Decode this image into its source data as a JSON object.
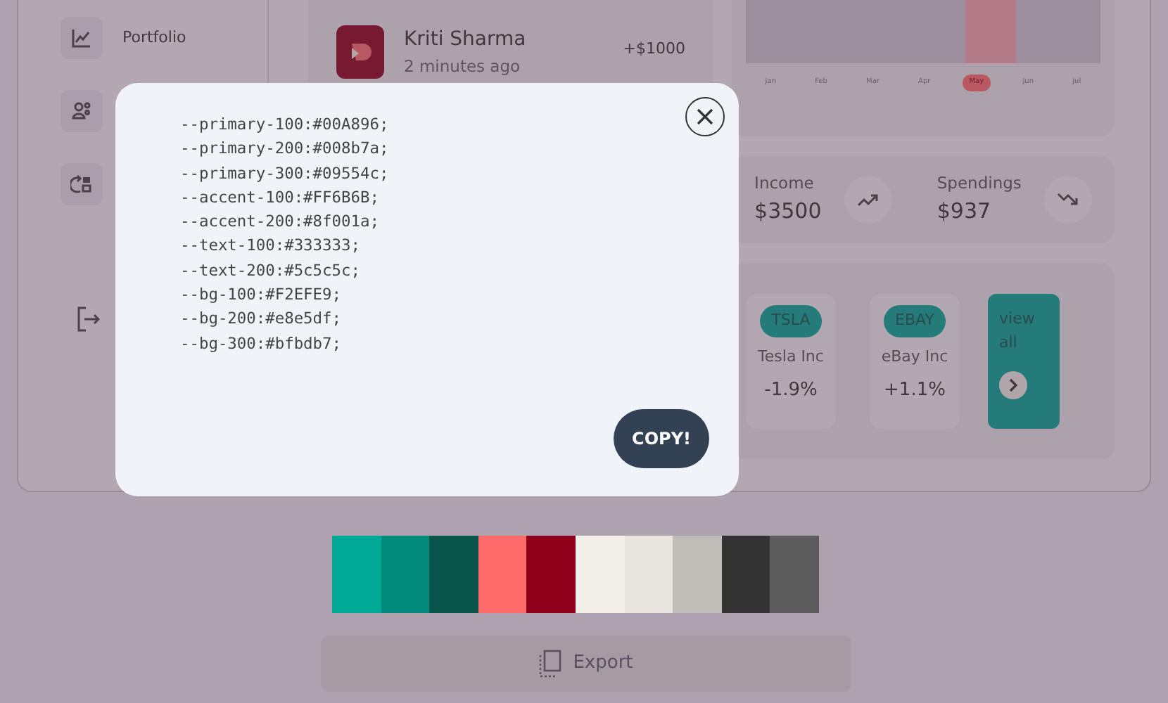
{
  "sidebar": {
    "items": [
      {
        "kind": "chart",
        "label": "Portfolio"
      },
      {
        "kind": "people"
      },
      {
        "kind": "switch"
      }
    ]
  },
  "transaction": {
    "name": "Kriti Sharma",
    "time": "2 minutes ago",
    "amount": "+$1000"
  },
  "chart": {
    "months": [
      {
        "label": "Jan",
        "selected": false
      },
      {
        "label": "Feb",
        "selected": false
      },
      {
        "label": "Mar",
        "selected": false
      },
      {
        "label": "Apr",
        "selected": false
      },
      {
        "label": "May",
        "selected": true
      },
      {
        "label": "Jun",
        "selected": false
      },
      {
        "label": "Jul",
        "selected": false
      }
    ]
  },
  "summary": [
    {
      "label": "Income",
      "value": "$3500",
      "kind": "up"
    },
    {
      "label": "Spendings",
      "value": "$937",
      "kind": "down"
    }
  ],
  "stocks": [
    {
      "ticker": "TSLA",
      "name": "Tesla Inc",
      "change": "-1.9%"
    },
    {
      "ticker": "EBAY",
      "name": "eBay Inc",
      "change": "+1.1%"
    }
  ],
  "view_all": "view all",
  "modal": {
    "lines": [
      "--primary-100:#00A896;",
      "--primary-200:#008b7a;",
      "--primary-300:#09554c;",
      "--accent-100:#FF6B6B;",
      "--accent-200:#8f001a;",
      "--text-100:#333333;",
      "--text-200:#5c5c5c;",
      "--bg-100:#F2EFE9;",
      "--bg-200:#e8e5df;",
      "--bg-300:#bfbdb7;"
    ],
    "copy_button": "COPY!"
  },
  "palette": [
    {
      "color": "#00a896"
    },
    {
      "color": "#008b7a"
    },
    {
      "color": "#09554c"
    },
    {
      "color": "#ff6b6b"
    },
    {
      "color": "#8f001a"
    },
    {
      "color": "#f2efe9"
    },
    {
      "color": "#e8e5df"
    },
    {
      "color": "#bfbdb7"
    },
    {
      "color": "#333333"
    },
    {
      "color": "#5c5c5c"
    }
  ],
  "export_button": "Export"
}
